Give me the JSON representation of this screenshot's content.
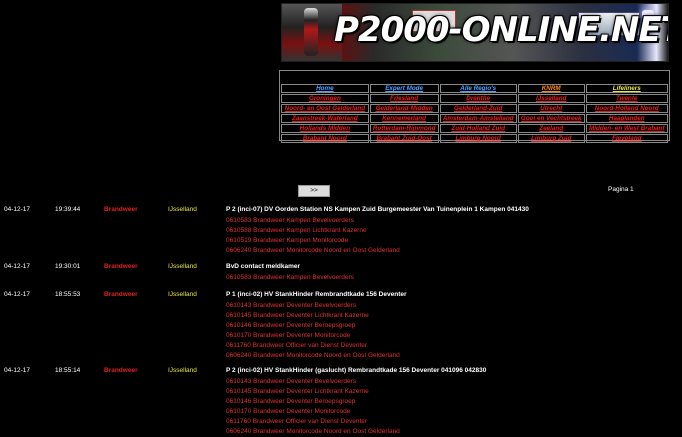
{
  "banner": {
    "title": "P2000-ONLINE.NET"
  },
  "nav": {
    "rows": [
      [
        {
          "label": "Home",
          "color": "blue"
        },
        {
          "label": "Expert Mode",
          "color": "blue"
        },
        {
          "label": "Alle Regio's",
          "color": "blue"
        },
        {
          "label": "KNRM",
          "color": "orange"
        },
        {
          "label": "Lifeliners",
          "color": "yellow"
        }
      ],
      [
        {
          "label": "Groningen",
          "color": "red"
        },
        {
          "label": "Friesland",
          "color": "red"
        },
        {
          "label": "Drenthe",
          "color": "red"
        },
        {
          "label": "IJsselland",
          "color": "red"
        },
        {
          "label": "Twente",
          "color": "red"
        }
      ],
      [
        {
          "label": "Noord- en Oost Gelderland",
          "color": "red"
        },
        {
          "label": "Gelderland-Midden",
          "color": "red"
        },
        {
          "label": "Gelderland-Zuid",
          "color": "red"
        },
        {
          "label": "Utrecht",
          "color": "red"
        },
        {
          "label": "Noord-Holland Noord",
          "color": "red"
        }
      ],
      [
        {
          "label": "Zaanstreek-Waterland",
          "color": "red"
        },
        {
          "label": "Kennemerland",
          "color": "red"
        },
        {
          "label": "Amsterdam-Amstelland",
          "color": "red"
        },
        {
          "label": "Gooi en Vechtstreek",
          "color": "red"
        },
        {
          "label": "Haaglanden",
          "color": "red"
        }
      ],
      [
        {
          "label": "Hollands Midden",
          "color": "red"
        },
        {
          "label": "Rotterdam-Rijnmond",
          "color": "red"
        },
        {
          "label": "Zuid-Holland Zuid",
          "color": "red"
        },
        {
          "label": "Zeeland",
          "color": "red"
        },
        {
          "label": "Midden- en West Brabant",
          "color": "red"
        }
      ],
      [
        {
          "label": "Brabant Noord",
          "color": "red"
        },
        {
          "label": "Brabant Zuid-Oost",
          "color": "red"
        },
        {
          "label": "Limburg Noord",
          "color": "red"
        },
        {
          "label": "Limburg Zuid",
          "color": "red"
        },
        {
          "label": "Flevoland",
          "color": "red"
        }
      ]
    ]
  },
  "pager": {
    "next_label": ">>",
    "page_label": "Pagina 1"
  },
  "messages": [
    {
      "date": "04-12-17",
      "time": "19:39:44",
      "service": "Brandweer",
      "region": "IJsselland",
      "text": "P 2 (inci-07) DV Oorden Station NS Kampen Zuid Burgemeester Van Tuinenplein 1 Kampen 041430",
      "capcodes": [
        "0610583 Brandweer Kampen Bevelvoerders",
        "0610588 Brandweer Kampen Lichtkrant Kazerne",
        "0610519 Brandweer Kampen Monitorcode",
        "0606240 Brandweer Monitorcode Noord en Oost Gelderland"
      ]
    },
    {
      "date": "04-12-17",
      "time": "19:30:01",
      "service": "Brandweer",
      "region": "IJsselland",
      "text": "BvD contact meldkamer",
      "capcodes": [
        "0610583 Brandweer Kampen Bevelvoerders"
      ]
    },
    {
      "date": "04-12-17",
      "time": "18:55:53",
      "service": "Brandweer",
      "region": "IJsselland",
      "text": "P 1 (inci-02) HV StankHinder Rembrandtkade 156 Deventer",
      "capcodes": [
        "0610143 Brandweer Deventer Bevelvoerders",
        "0610145 Brandweer Deventer Lichtkrant Kazerne",
        "0610146 Brandweer Deventer Beroepsgroep",
        "0610170 Brandweer Deventer Monitorcode",
        "0611760 Brandweer Officier van Dienst Deventer",
        "0606240 Brandweer Monitorcode Noord en Oost Gelderland"
      ]
    },
    {
      "date": "04-12-17",
      "time": "18:55:14",
      "service": "Brandweer",
      "region": "IJsselland",
      "text": "P 2 (inci-02) HV StankHinder (gaslucht) Rembrandtkade 156 Deventer 041096 042830",
      "capcodes": [
        "0610143 Brandweer Deventer Bevelvoerders",
        "0610145 Brandweer Deventer Lichtkrant Kazerne",
        "0610146 Brandweer Deventer Beroepsgroep",
        "0610170 Brandweer Deventer Monitorcode",
        "0611760 Brandweer Officier van Dienst Deventer",
        "0606240 Brandweer Monitorcode Noord en Oost Gelderland"
      ]
    }
  ],
  "colors": {
    "blue": "#4aa3ff",
    "red": "#e02020",
    "orange": "#ff8800",
    "yellow": "#e8e840",
    "capcode": "#e03030"
  }
}
